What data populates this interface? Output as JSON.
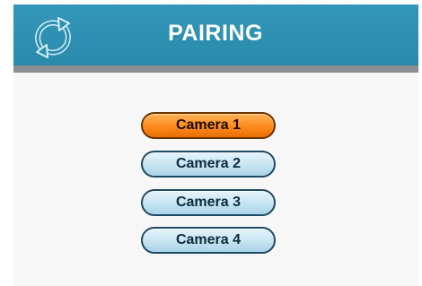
{
  "header": {
    "title": "PAIRING",
    "icon": "sync-icon"
  },
  "colors": {
    "header": "#2d8fb0",
    "rule": "#8a8f92",
    "selected": "#ff8a1c",
    "unselected": "#c6e4f2"
  },
  "cameras": [
    {
      "label": "Camera 1",
      "selected": true
    },
    {
      "label": "Camera 2",
      "selected": false
    },
    {
      "label": "Camera 3",
      "selected": false
    },
    {
      "label": "Camera 4",
      "selected": false
    }
  ]
}
